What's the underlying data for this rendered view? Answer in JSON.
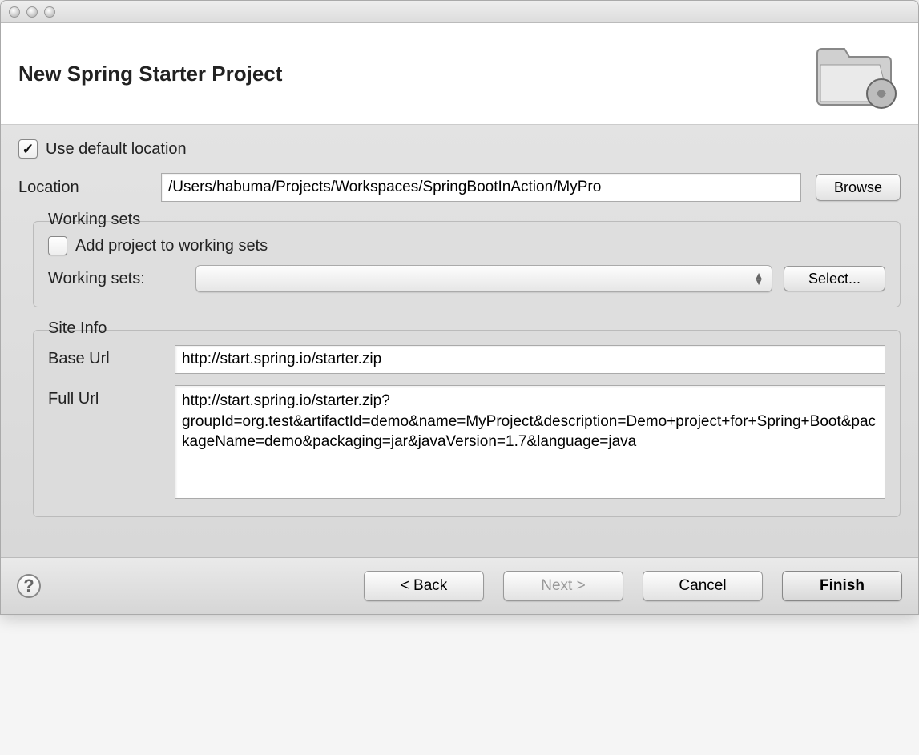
{
  "header": {
    "title": "New Spring Starter Project"
  },
  "form": {
    "use_default_location_label": "Use default location",
    "use_default_location_checked": true,
    "location_label": "Location",
    "location_value": "/Users/habuma/Projects/Workspaces/SpringBootInAction/MyPro",
    "browse_label": "Browse"
  },
  "working_sets": {
    "legend": "Working sets",
    "add_label": "Add project to working sets",
    "add_checked": false,
    "dropdown_label": "Working sets:",
    "dropdown_value": "",
    "select_label": "Select..."
  },
  "site_info": {
    "legend": "Site Info",
    "base_url_label": "Base Url",
    "base_url_value": "http://start.spring.io/starter.zip",
    "full_url_label": "Full Url",
    "full_url_value": "http://start.spring.io/starter.zip?groupId=org.test&artifactId=demo&name=MyProject&description=Demo+project+for+Spring+Boot&packageName=demo&packaging=jar&javaVersion=1.7&language=java"
  },
  "footer": {
    "back_label": "< Back",
    "next_label": "Next >",
    "cancel_label": "Cancel",
    "finish_label": "Finish"
  }
}
